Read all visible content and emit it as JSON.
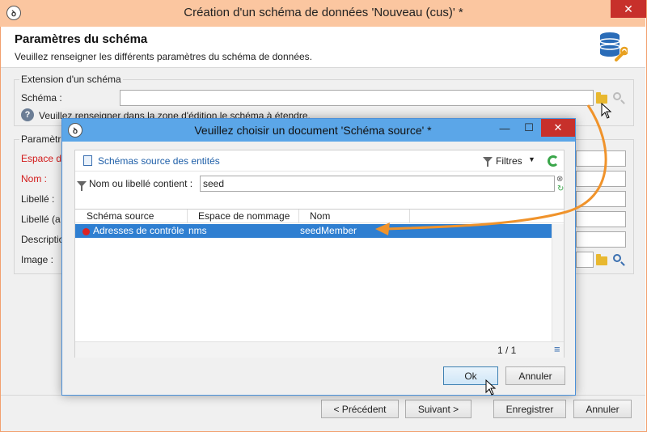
{
  "main_window": {
    "title": "Création d'un schéma de données 'Nouveau (cus)' *",
    "close_glyph": "✕",
    "logo_glyph": "ꝺ"
  },
  "header": {
    "title": "Paramètres du schéma",
    "subtitle": "Veuillez renseigner les différents paramètres du schéma de données."
  },
  "extension_group": {
    "label": "Extension d'un schéma",
    "schema_label": "Schéma :",
    "schema_value": "",
    "info_text": "Veuillez renseigner dans la zone d'édition le schéma à étendre."
  },
  "params_group": {
    "label": "Paramètr",
    "fields": {
      "namespace": "Espace de",
      "name": "Nom :",
      "label": "Libellé :",
      "label_plural": "Libellé (a",
      "description": "Descriptio",
      "image": "Image :"
    }
  },
  "bottom_buttons": {
    "previous": "< Précédent",
    "next": "Suivant >",
    "save": "Enregistrer",
    "cancel": "Annuler"
  },
  "dialog": {
    "title": "Veuillez choisir un document 'Schéma source' *",
    "minimize_glyph": "—",
    "maximize_glyph": "☐",
    "close_glyph": "✕",
    "panel_title": "Schémas source des entités",
    "filters_label": "Filtres",
    "search_label": "Nom ou libellé contient :",
    "search_value": "seed",
    "columns": [
      "Schéma source",
      "Espace de nommage",
      "Nom"
    ],
    "rows": [
      {
        "source": "Adresses de contrôle",
        "namespace": "nms",
        "name": "seedMember",
        "selected": true
      }
    ],
    "pagination": "1 / 1",
    "ok_label": "Ok",
    "cancel_label": "Annuler"
  },
  "colors": {
    "main_titlebar": "#fbc6a0",
    "dialog_titlebar": "#5ba6e8",
    "selection": "#2f7fd1",
    "required_label": "#d21a1a",
    "arrow": "#f0932b",
    "link": "#1f5fa8"
  }
}
